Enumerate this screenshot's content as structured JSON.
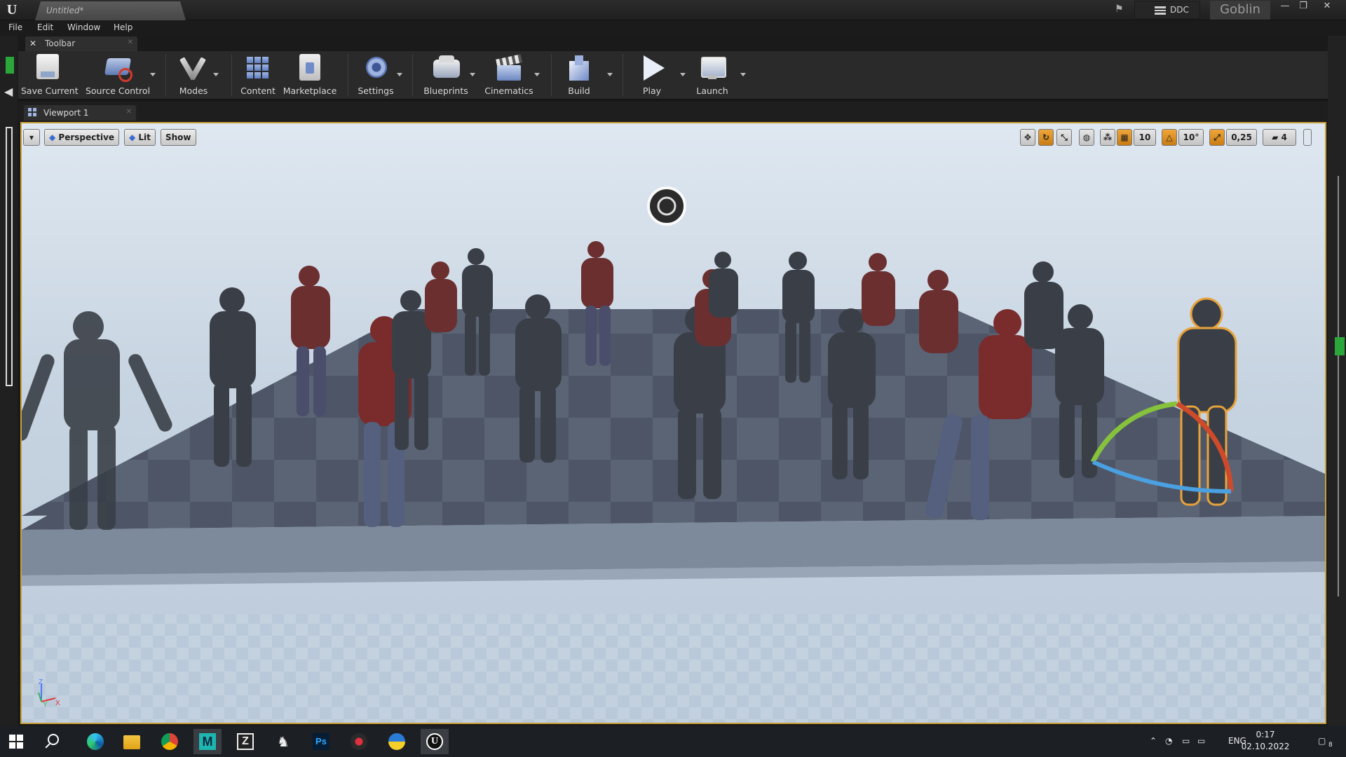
{
  "titlebar": {
    "document_tab": "Untitled*",
    "ddc_label": "DDC",
    "project_name": "Goblin",
    "window_controls": [
      "—",
      "❐",
      "✕"
    ]
  },
  "menu": [
    "File",
    "Edit",
    "Window",
    "Help"
  ],
  "toolbar_tab": {
    "label": "Toolbar"
  },
  "toolbar": {
    "buttons": [
      {
        "label": "Save Current",
        "icon": "save-icon"
      },
      {
        "label": "Source Control",
        "icon": "source-control-icon"
      },
      {
        "label": "Modes",
        "icon": "modes-icon"
      },
      {
        "label": "Content",
        "icon": "content-icon"
      },
      {
        "label": "Marketplace",
        "icon": "marketplace-icon"
      },
      {
        "label": "Settings",
        "icon": "settings-icon"
      },
      {
        "label": "Blueprints",
        "icon": "blueprints-icon"
      },
      {
        "label": "Cinematics",
        "icon": "cinematics-icon"
      },
      {
        "label": "Build",
        "icon": "build-icon"
      },
      {
        "label": "Play",
        "icon": "play-icon"
      },
      {
        "label": "Launch",
        "icon": "launch-icon"
      }
    ]
  },
  "viewport_tab": {
    "label": "Viewport 1"
  },
  "viewport": {
    "view_mode": "Perspective",
    "lighting": "Lit",
    "show_label": "Show",
    "grid_snap": "10",
    "rotation_snap": "10°",
    "scale_snap": "0,25",
    "camera_speed": "4",
    "selection_color": "#e8a33a"
  },
  "taskbar": {
    "apps": [
      "edge-icon",
      "file-explorer-icon",
      "chrome-icon",
      "maya-icon",
      "zbrush-icon",
      "goat-app-icon",
      "photoshop-icon",
      "red-app-icon",
      "ua-app-icon",
      "unreal-engine-icon"
    ],
    "maya_label": "M",
    "photoshop_label": "Ps",
    "language": "ENG",
    "time": "0:17",
    "date": "02.10.2022",
    "notification_count": "8"
  }
}
